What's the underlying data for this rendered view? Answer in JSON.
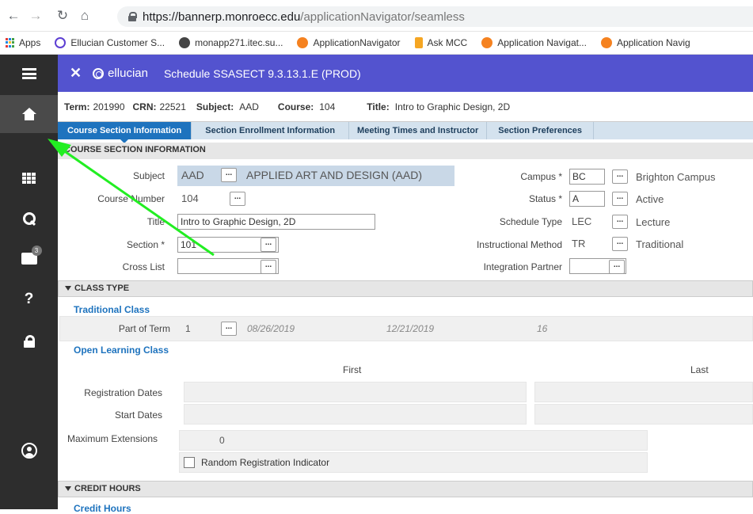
{
  "browser": {
    "url_host": "https://bannerp.monroecc.edu",
    "url_path": "/applicationNavigator/seamless",
    "bookmarks": [
      {
        "label": "Apps",
        "color": "#e53935"
      },
      {
        "label": "Ellucian Customer S...",
        "color": "#5d3fd3"
      },
      {
        "label": "monapp271.itec.su...",
        "color": "#444444"
      },
      {
        "label": "ApplicationNavigator",
        "color": "#f58220"
      },
      {
        "label": "Ask MCC",
        "color": "#f5a623"
      },
      {
        "label": "Application Navigat...",
        "color": "#f58220"
      },
      {
        "label": "Application Navig",
        "color": "#f58220"
      }
    ]
  },
  "sidebar": {
    "folder_badge": "3"
  },
  "header": {
    "brand": "ellucian",
    "title": "Schedule SSASECT 9.3.13.1.E (PROD)"
  },
  "keyblock": {
    "term_label": "Term:",
    "term": "201990",
    "crn_label": "CRN:",
    "crn": "22521",
    "subject_label": "Subject:",
    "subject": "AAD",
    "course_label": "Course:",
    "course": "104",
    "title_label": "Title:",
    "title": "Intro to Graphic Design, 2D"
  },
  "tabs": [
    "Course Section Information",
    "Section Enrollment Information",
    "Meeting Times and Instructor",
    "Section Preferences"
  ],
  "section_info": {
    "heading": "COURSE SECTION INFORMATION",
    "subject_label": "Subject",
    "subject_value": "AAD",
    "subject_desc": "APPLIED ART AND DESIGN (AAD)",
    "course_number_label": "Course Number",
    "course_number": "104",
    "title_label": "Title",
    "title_value": "Intro to Graphic Design, 2D",
    "section_label": "Section *",
    "section_value": "101",
    "cross_list_label": "Cross List",
    "cross_list_value": "",
    "campus_label": "Campus *",
    "campus_code": "BC",
    "campus_desc": "Brighton Campus",
    "status_label": "Status *",
    "status_code": "A",
    "status_desc": "Active",
    "schedule_type_label": "Schedule Type",
    "schedule_type_code": "LEC",
    "schedule_type_desc": "Lecture",
    "instr_method_label": "Instructional Method",
    "instr_method_code": "TR",
    "instr_method_desc": "Traditional",
    "integration_label": "Integration Partner",
    "integration_value": ""
  },
  "class_type": {
    "heading": "CLASS TYPE",
    "traditional_label": "Traditional Class",
    "part_of_term_label": "Part of Term",
    "part_of_term": "1",
    "start_date": "08/26/2019",
    "end_date": "12/21/2019",
    "weeks": "16",
    "open_learning_label": "Open Learning Class",
    "first_label": "First",
    "last_label": "Last",
    "reg_dates_label": "Registration Dates",
    "start_dates_label": "Start Dates",
    "max_ext_label": "Maximum Extensions",
    "max_ext": "0",
    "random_reg_label": "Random Registration Indicator"
  },
  "credit_hours": {
    "heading": "CREDIT HOURS",
    "sub_label": "Credit Hours"
  },
  "dots_label": "..."
}
